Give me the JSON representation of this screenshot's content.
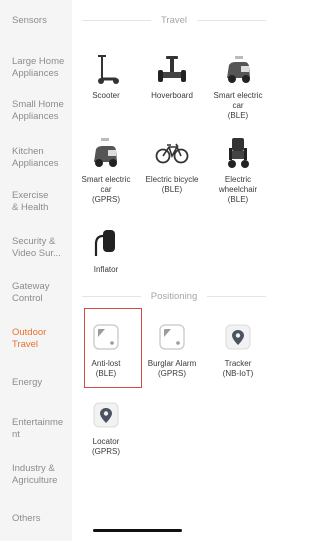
{
  "sidebar": {
    "items": [
      {
        "label": "Sensors"
      },
      {
        "label": "Large Home\nAppliances"
      },
      {
        "label": "Small Home\nAppliances"
      },
      {
        "label": "Kitchen\nAppliances"
      },
      {
        "label": "Exercise\n& Health"
      },
      {
        "label": "Security &\nVideo Sur..."
      },
      {
        "label": "Gateway\nControl"
      },
      {
        "label": "Outdoor\nTravel"
      },
      {
        "label": "Energy"
      },
      {
        "label": "Entertainme\nnt"
      },
      {
        "label": "Industry &\nAgriculture"
      },
      {
        "label": "Others"
      }
    ],
    "active_color": "#e8722c"
  },
  "sections": {
    "travel": {
      "title": "Travel",
      "devices": [
        {
          "label": "Scooter",
          "icon": "scooter-icon"
        },
        {
          "label": "Hoverboard",
          "icon": "hoverboard-icon"
        },
        {
          "label": "Smart electric\ncar\n(BLE)",
          "icon": "electric-car-icon"
        },
        {
          "label": "Smart electric\ncar\n(GPRS)",
          "icon": "electric-car-icon"
        },
        {
          "label": "Electric bicycle\n(BLE)",
          "icon": "bicycle-icon"
        },
        {
          "label": "Electric\nwheelchair\n(BLE)",
          "icon": "wheelchair-icon"
        },
        {
          "label": "Inflator",
          "icon": "inflator-icon"
        }
      ]
    },
    "positioning": {
      "title": "Positioning",
      "devices": [
        {
          "label": "Anti-lost\n(BLE)",
          "icon": "anti-lost-tag-icon"
        },
        {
          "label": "Burglar Alarm\n(GPRS)",
          "icon": "burglar-alarm-tag-icon"
        },
        {
          "label": "Tracker\n(NB-IoT)",
          "icon": "location-pin-icon"
        },
        {
          "label": "Locator\n(GPRS)",
          "icon": "location-pin-icon"
        }
      ]
    }
  }
}
